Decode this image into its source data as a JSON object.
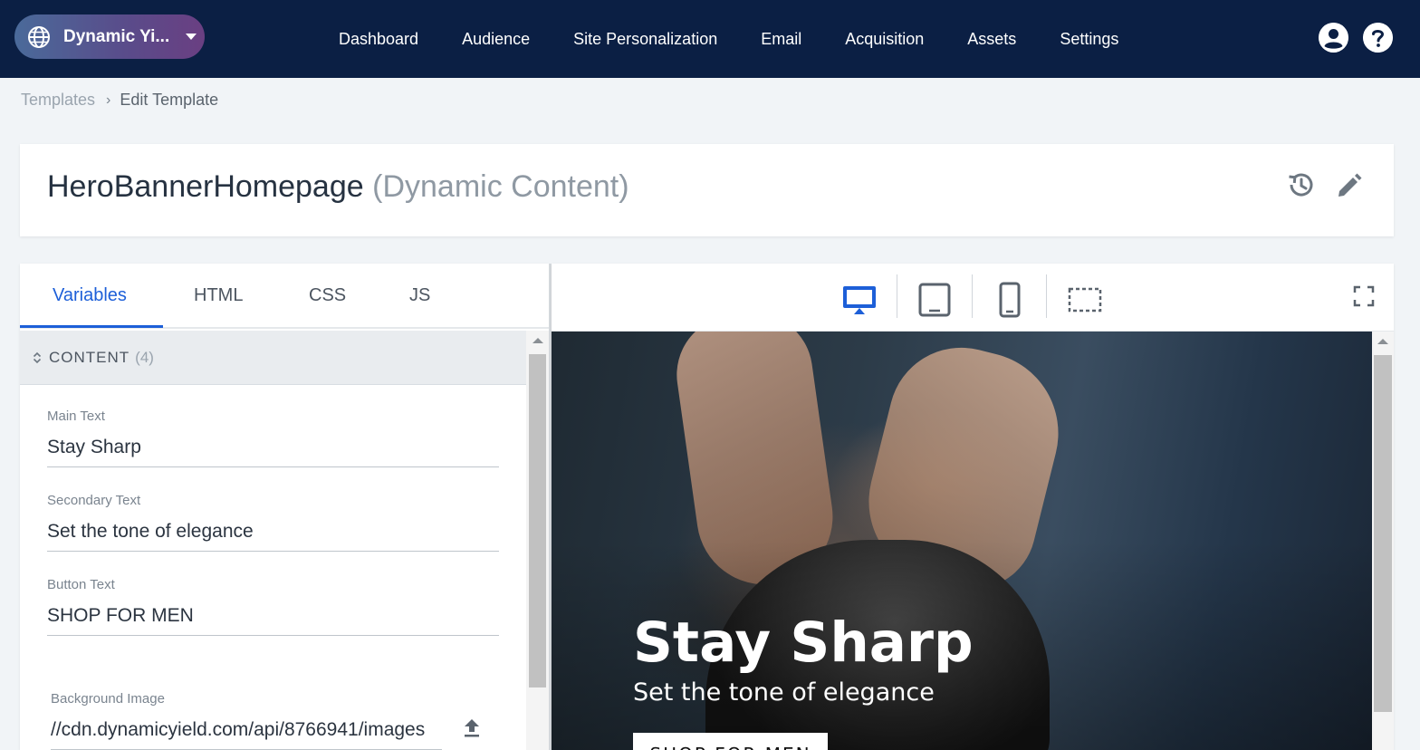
{
  "header": {
    "site_name": "Dynamic Yi...",
    "nav": [
      "Dashboard",
      "Audience",
      "Site Personalization",
      "Email",
      "Acquisition",
      "Assets",
      "Settings"
    ]
  },
  "breadcrumb": {
    "parent": "Templates",
    "current": "Edit Template"
  },
  "template": {
    "name": "HeroBannerHomepage",
    "type": "(Dynamic Content)"
  },
  "editor": {
    "tabs": [
      "Variables",
      "HTML",
      "CSS",
      "JS"
    ],
    "active_tab": "Variables",
    "section": {
      "label": "CONTENT",
      "count": "(4)"
    },
    "fields": {
      "main_text": {
        "label": "Main Text",
        "value": "Stay Sharp"
      },
      "secondary_text": {
        "label": "Secondary Text",
        "value": "Set the tone of elegance"
      },
      "button_text": {
        "label": "Button Text",
        "value": "SHOP FOR MEN"
      },
      "background_image": {
        "label": "Background Image",
        "value": "//cdn.dynamicyield.com/api/8766941/images"
      }
    }
  },
  "preview": {
    "active_device": "desktop",
    "devices": [
      "desktop",
      "tablet",
      "mobile",
      "custom-size"
    ],
    "headline": "Stay Sharp",
    "subline": "Set the tone of elegance",
    "cta": "SHOP FOR MEN"
  },
  "colors": {
    "nav_background": "#0b1f44",
    "accent": "#1d5fd8"
  }
}
